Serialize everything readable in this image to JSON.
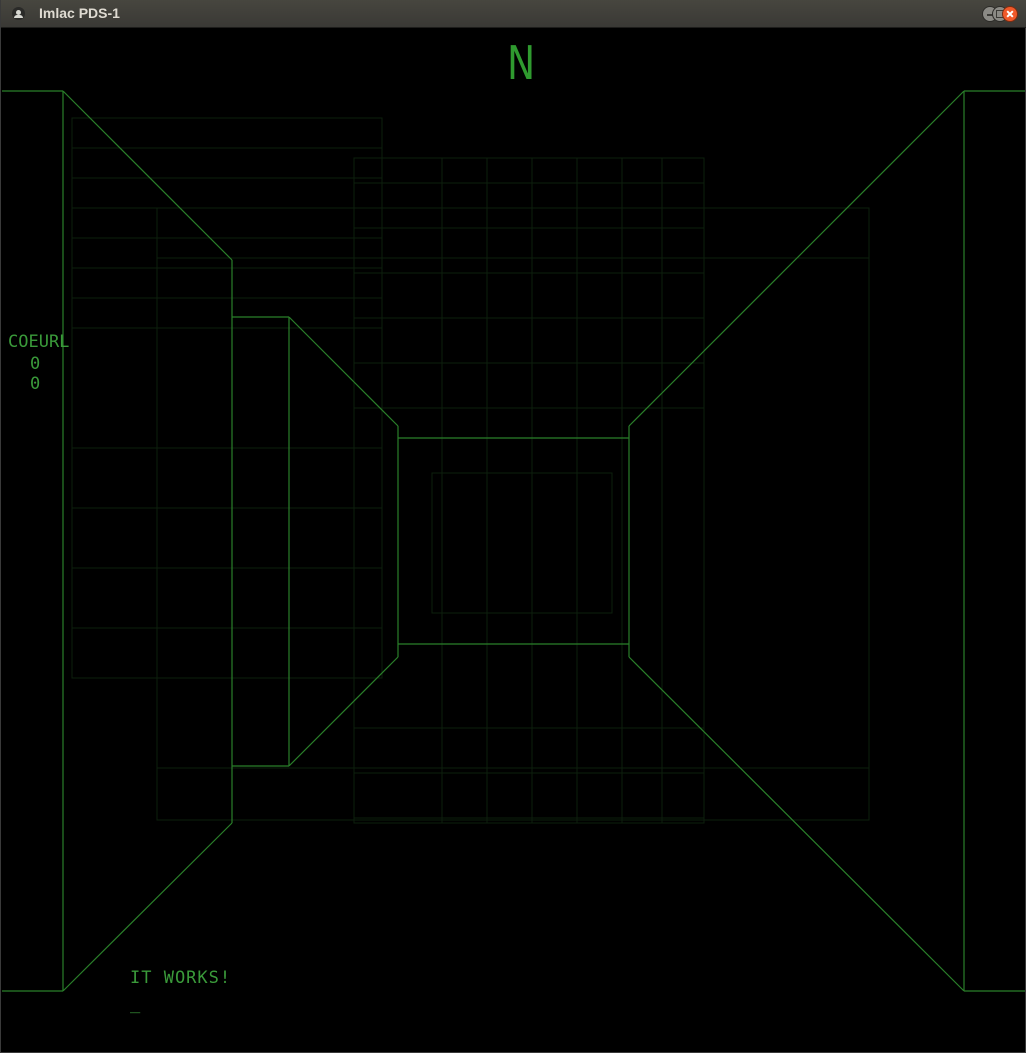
{
  "window": {
    "title": "Imlac PDS-1",
    "app_icon": "imlac-app-icon",
    "controls": {
      "minimize": "minimize-icon",
      "maximize": "maximize-icon",
      "close": "close-icon"
    }
  },
  "game": {
    "compass": "N",
    "player": {
      "name": "COEURL",
      "stat1": "0",
      "stat2": "0"
    },
    "message": "IT WORKS!",
    "prompt": "_",
    "colors": {
      "vector": "#2f8a2f",
      "ghost": "#0f250f",
      "background": "#000000"
    }
  }
}
